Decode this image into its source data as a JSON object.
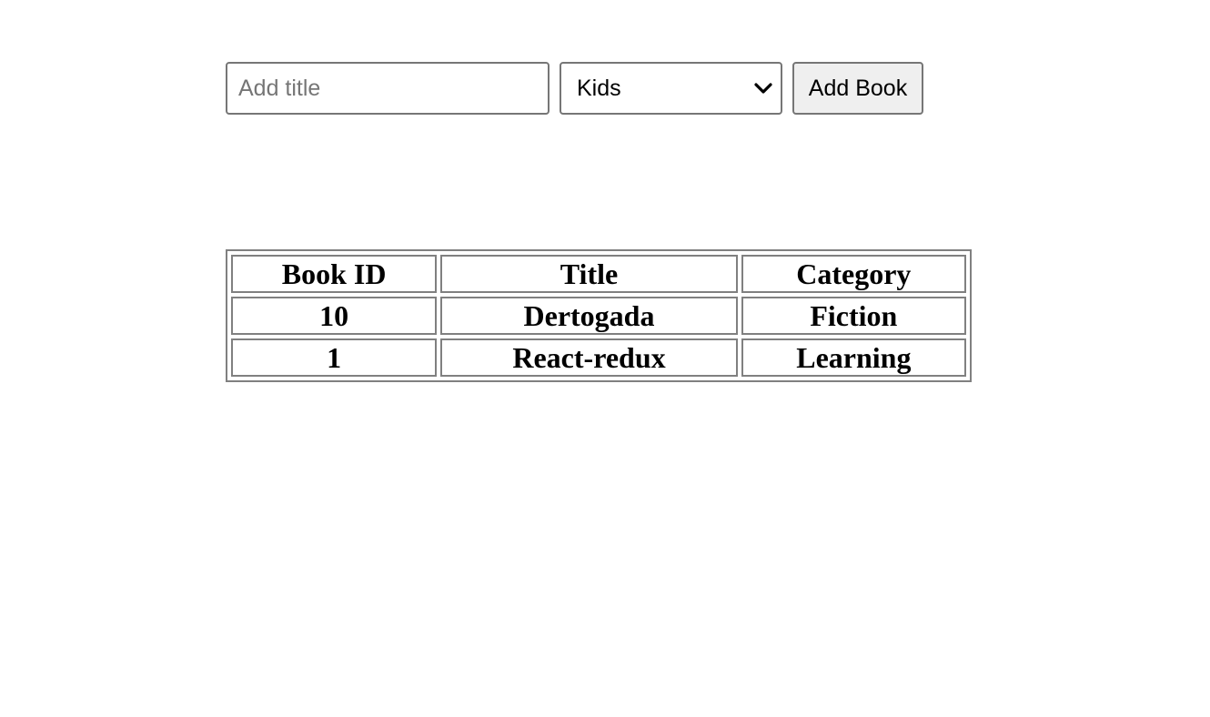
{
  "form": {
    "title_input": {
      "value": "",
      "placeholder": "Add title"
    },
    "category_select": {
      "selected": "Kids"
    },
    "add_button_label": "Add Book"
  },
  "table": {
    "headers": [
      "Book ID",
      "Title",
      "Category"
    ],
    "rows": [
      [
        "10",
        "Dertogada",
        "Fiction"
      ],
      [
        "1",
        "React-redux",
        "Learning"
      ]
    ]
  },
  "colors": {
    "border": "#808080",
    "button_bg": "#efefef",
    "placeholder": "#767676"
  }
}
